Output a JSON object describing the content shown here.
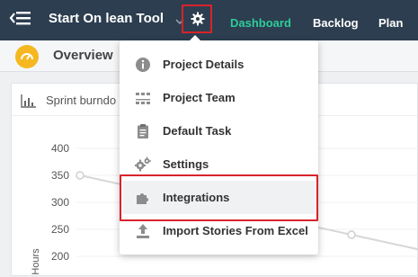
{
  "header": {
    "project_title": "Start On lean Tool",
    "nav": [
      {
        "label": "Dashboard",
        "active": true
      },
      {
        "label": "Backlog",
        "active": false
      },
      {
        "label": "Plan",
        "active": false
      }
    ],
    "active_color": "#2ecc9a",
    "background": "#2c3e50"
  },
  "subheader": {
    "title": "Overview",
    "badge_color": "#f5b820"
  },
  "card": {
    "title": "Sprint burndo"
  },
  "chart_data": {
    "type": "line",
    "ylabel": "Hours",
    "yticks": [
      400,
      350,
      300,
      250,
      200
    ],
    "series": [
      {
        "points": [
          {
            "y": 350
          },
          {
            "y": 240
          }
        ]
      }
    ]
  },
  "settings_menu": {
    "items": [
      {
        "label": "Project Details",
        "icon": "info-icon"
      },
      {
        "label": "Project Team",
        "icon": "team-icon"
      },
      {
        "label": "Default Task",
        "icon": "clipboard-icon"
      },
      {
        "label": "Settings",
        "icon": "gears-icon"
      },
      {
        "label": "Integrations",
        "icon": "puzzle-icon",
        "highlighted": true
      },
      {
        "label": "Import Stories From Excel",
        "icon": "upload-icon"
      }
    ],
    "annotation_color": "#d8232a"
  }
}
